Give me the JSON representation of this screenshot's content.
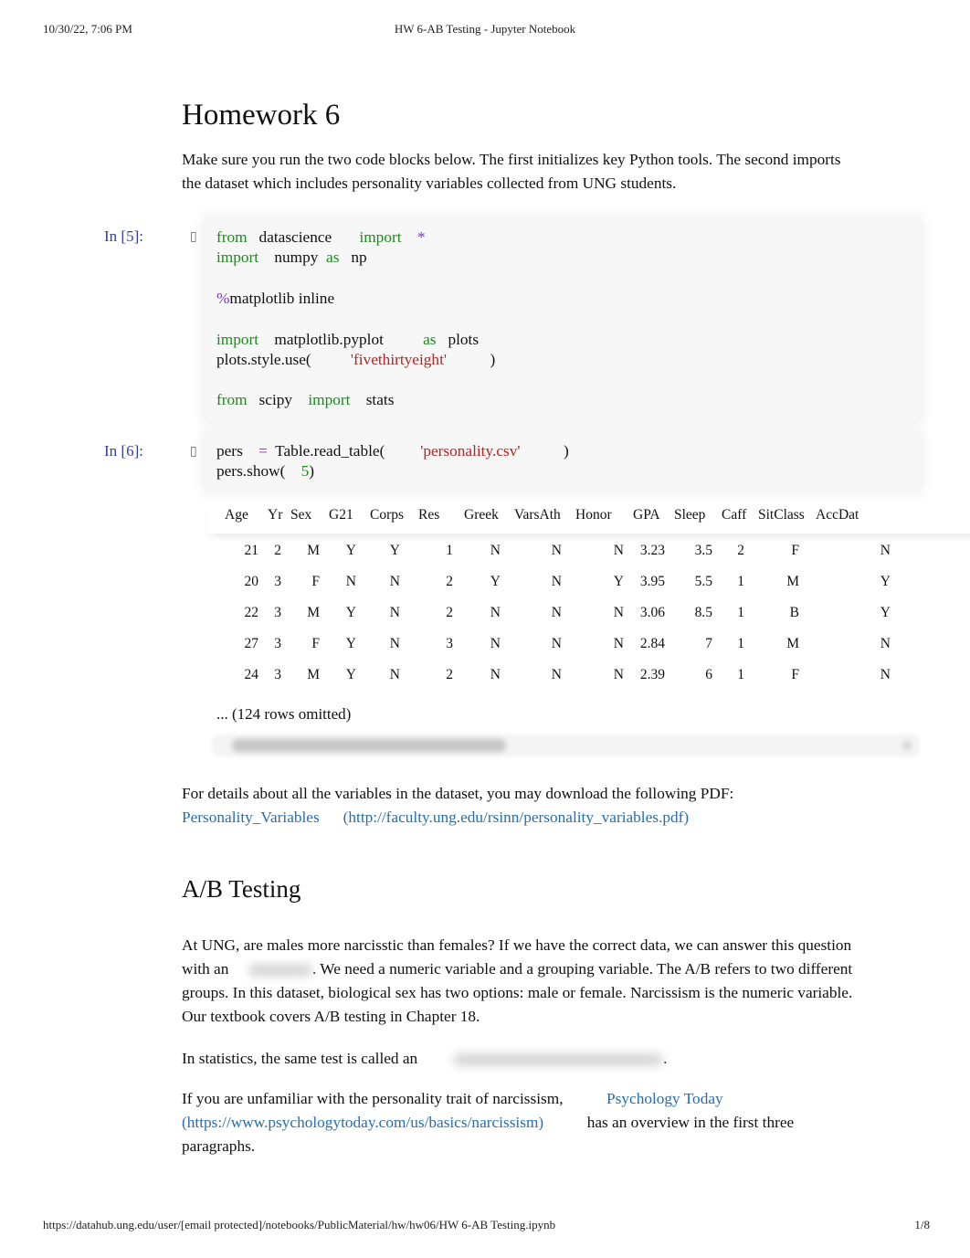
{
  "print_header": {
    "datetime": "10/30/22, 7:06 PM",
    "title": "HW 6-AB Testing - Jupyter Notebook"
  },
  "print_footer": {
    "url": "https://datahub.ung.edu/user/[email protected]/notebooks/PublicMaterial/hw/hw06/HW 6-AB Testing.ipynb",
    "page": "1/8"
  },
  "intro": {
    "heading": "Homework 6",
    "paragraph": "Make sure you run the two code blocks below. The first initializes key Python tools. The second imports the dataset which includes personality variables collected from UNG students."
  },
  "cells": [
    {
      "prompt": "In [5]:",
      "collapser_icon": "collapse-arrow",
      "lines": [
        [
          {
            "t": "from",
            "c": "kw"
          },
          {
            "t": "   datascience       ",
            "c": ""
          },
          {
            "t": "import",
            "c": "kw"
          },
          {
            "t": "    ",
            "c": ""
          },
          {
            "t": "*",
            "c": "op"
          }
        ],
        [
          {
            "t": "import",
            "c": "kw"
          },
          {
            "t": "    numpy  ",
            "c": ""
          },
          {
            "t": "as",
            "c": "kw"
          },
          {
            "t": "   np",
            "c": ""
          }
        ],
        [],
        [
          {
            "t": "%",
            "c": "mag"
          },
          {
            "t": "matplotlib inline",
            "c": ""
          }
        ],
        [],
        [
          {
            "t": "import",
            "c": "kw"
          },
          {
            "t": "    matplotlib.pyplot          ",
            "c": ""
          },
          {
            "t": "as",
            "c": "kw"
          },
          {
            "t": "   plots",
            "c": ""
          }
        ],
        [
          {
            "t": "plots.style.use(          ",
            "c": ""
          },
          {
            "t": "'fivethirtyeight'",
            "c": "str"
          },
          {
            "t": "           )",
            "c": ""
          }
        ],
        [],
        [
          {
            "t": "from",
            "c": "kw"
          },
          {
            "t": "   scipy    ",
            "c": ""
          },
          {
            "t": "import",
            "c": "kw"
          },
          {
            "t": "    stats",
            "c": ""
          }
        ]
      ]
    },
    {
      "prompt": "In [6]:",
      "collapser_icon": "collapse-arrow",
      "lines": [
        [
          {
            "t": "pers    ",
            "c": ""
          },
          {
            "t": "=",
            "c": "op"
          },
          {
            "t": "  Table.read_table(         ",
            "c": ""
          },
          {
            "t": "'personality.csv'",
            "c": "str"
          },
          {
            "t": "           )",
            "c": ""
          }
        ],
        [
          {
            "t": "pers.show(    ",
            "c": ""
          },
          {
            "t": "5",
            "c": "num"
          },
          {
            "t": ")",
            "c": ""
          }
        ]
      ]
    }
  ],
  "output_table": {
    "columns": [
      "Age",
      "Yr",
      "Sex",
      "G21",
      "Corps",
      "Res",
      "Greek",
      "VarsAth",
      "Honor",
      "GPA",
      "Sleep",
      "Caff",
      "SitClass",
      "AccDat"
    ],
    "rows": [
      [
        "21",
        "2",
        "M",
        "Y",
        "Y",
        "1",
        "N",
        "N",
        "N",
        "3.23",
        "3.5",
        "2",
        "F",
        "N"
      ],
      [
        "20",
        "3",
        "F",
        "N",
        "N",
        "2",
        "Y",
        "N",
        "Y",
        "3.95",
        "5.5",
        "1",
        "M",
        "Y"
      ],
      [
        "22",
        "3",
        "M",
        "Y",
        "N",
        "2",
        "N",
        "N",
        "N",
        "3.06",
        "8.5",
        "1",
        "B",
        "Y"
      ],
      [
        "27",
        "3",
        "F",
        "Y",
        "N",
        "3",
        "N",
        "N",
        "N",
        "2.84",
        "7",
        "1",
        "M",
        "N"
      ],
      [
        "24",
        "3",
        "M",
        "Y",
        "N",
        "2",
        "N",
        "N",
        "N",
        "2.39",
        "6",
        "1",
        "F",
        "N"
      ]
    ],
    "omitted_text": "... (124 rows omitted)"
  },
  "variables_note": {
    "text": "For details about all the variables in the dataset, you may download the following PDF:",
    "link_label": "Personality_Variables",
    "link_url_text": "(http://faculty.ung.edu/rsinn/personality_variables.pdf)"
  },
  "ab_section": {
    "heading": "A/B Testing",
    "p1_part1": "At UNG, are males more narcisstic than females? If we have the correct data, we can answer this question with an",
    "p1_part2": ". We need a numeric variable and a grouping variable. The A/B refers to two different groups. In this dataset, biological sex has two options: male or female. Narcissism is the numeric variable. Our textbook covers A/B testing in Chapter 18.",
    "p2_part1": "In statistics, the same test is called an",
    "p2_part2": ".",
    "p3_part1": "If you are unfamiliar with the personality trait of narcissism,",
    "p3_link_label": "Psychology Today",
    "p3_link_url_text": "(https://www.psychologytoday.com/us/basics/narcissism)",
    "p3_part2": "has an overview in the first three paragraphs."
  },
  "colors": {
    "prompt": "#303f9f",
    "keyword": "#1b8b1b",
    "string": "#ba2121",
    "operator": "#7c2fb6",
    "link": "#296eaa"
  }
}
